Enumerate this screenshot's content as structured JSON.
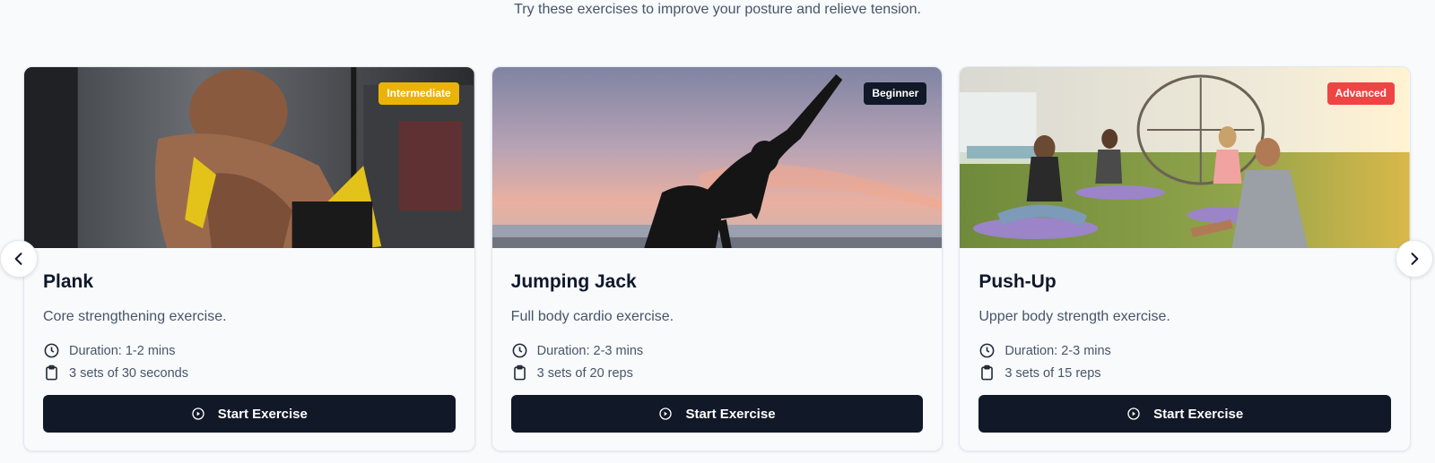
{
  "header": {
    "subtitle": "Try these exercises to improve your posture and relieve tension."
  },
  "carousel": {
    "prev_icon": "chevron-left-icon",
    "next_icon": "chevron-right-icon",
    "cards": [
      {
        "title": "Plank",
        "description": "Core strengthening exercise.",
        "level": "Intermediate",
        "level_color": "#eab308",
        "duration": "Duration: 1-2 mins",
        "sets": "3 sets of 30 seconds",
        "button_label": "Start Exercise"
      },
      {
        "title": "Jumping Jack",
        "description": "Full body cardio exercise.",
        "level": "Beginner",
        "level_color": "#111827",
        "duration": "Duration: 2-3 mins",
        "sets": "3 sets of 20 reps",
        "button_label": "Start Exercise"
      },
      {
        "title": "Push-Up",
        "description": "Upper body strength exercise.",
        "level": "Advanced",
        "level_color": "#ef4444",
        "duration": "Duration: 2-3 mins",
        "sets": "3 sets of 15 reps",
        "button_label": "Start Exercise"
      }
    ]
  }
}
